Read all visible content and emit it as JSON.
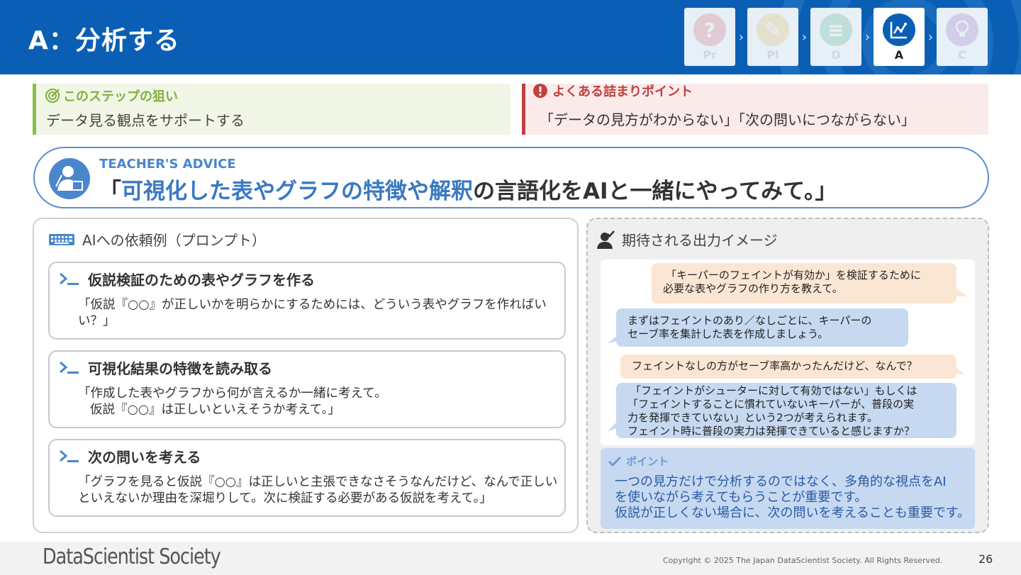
{
  "header": {
    "title": "A：分析する",
    "steps": [
      {
        "label": "Pr",
        "glyph": "?",
        "color": "#e74c4c"
      },
      {
        "label": "Pl",
        "glyph": "✎",
        "color": "#f0b32e"
      },
      {
        "label": "D",
        "glyph": "≡",
        "color": "#3cad6a"
      },
      {
        "label": "A",
        "glyph": "",
        "color": "#0a5fb4"
      },
      {
        "label": "C",
        "glyph": "",
        "color": "#9b59b6"
      }
    ],
    "step_separator": "›"
  },
  "aim": {
    "heading": "このステップの狙い",
    "body": "データ見る観点をサポートする"
  },
  "stuck": {
    "heading": "よくある詰まりポイント",
    "body": "「データの見方がわからない」「次の問いにつながらない」"
  },
  "advice": {
    "tag": "TEACHER'S ADVICE",
    "quote_open": "「",
    "quote_highlight": "可視化した表やグラフの特徴や解釈",
    "quote_rest": "の言語化をAIと一緒にやってみて。」"
  },
  "prompts": {
    "heading": "AIへの依頼例（プロンプト）",
    "cards": [
      {
        "title": "仮説検証のための表やグラフを作る",
        "body": "「仮説『○○』が正しいかを明らかにするためには、どういう表やグラフを作ればいい？」"
      },
      {
        "title": "可視化結果の特徴を読み取る",
        "line1": "「作成した表やグラフから何が言えるか一緒に考えて。",
        "line2": "仮説『○○』は正しいといえそうか考えて。」"
      },
      {
        "title": "次の問いを考える",
        "body": "「グラフを見ると仮説『○○』は正しいと主張できなさそうなんだけど、なんで正しいといえないか理由を深堀りして。次に検証する必要がある仮説を考えて。」"
      }
    ]
  },
  "output": {
    "heading": "期待される出力イメージ",
    "chat": [
      {
        "role": "user",
        "lines": [
          "「キーパーのフェイントが有効か」を検証するために",
          "必要な表やグラフの作り方を教えて。"
        ]
      },
      {
        "role": "ai",
        "lines": [
          "まずはフェイントのあり／なしごとに、キーパーの",
          "セーブ率を集計した表を作成しましょう。"
        ]
      },
      {
        "role": "user",
        "lines": [
          "フェイントなしの方がセーブ率高かったんだけど、なんで？"
        ]
      },
      {
        "role": "ai",
        "lines": [
          "「フェイントがシューターに対して有効ではない」もしくは",
          "「フェイントすることに慣れていないキーパーが、普段の実",
          "力を発揮できていない」という2つが考えられます。",
          "フェイント時に普段の実力は発揮できていると感じますか？"
        ]
      }
    ],
    "point": {
      "tag": "ポイント",
      "lines": [
        "一つの見方だけで分析するのではなく、多角的な視点をAI",
        "を使いながら考えてもらうことが重要です。",
        "仮説が正しくない場合に、次の問いを考えることも重要です。"
      ]
    }
  },
  "footer": {
    "logo": "DataScientist Society",
    "copyright": "Copyright © 2025 The Japan DataScientist Society. All Rights Reserved.",
    "page": "26"
  }
}
